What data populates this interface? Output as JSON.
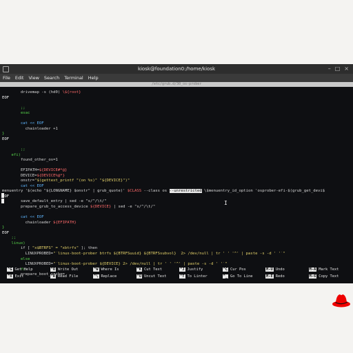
{
  "window": {
    "title": "kiosk@foundation0:/home/kiosk"
  },
  "menu": [
    "File",
    "Edit",
    "View",
    "Search",
    "Terminal",
    "Help"
  ],
  "editor": {
    "header_text": "/etc/grub.d/30_os-prober",
    "lines": [
      [
        {
          "t": "        drivemap -s (hd0) "
        },
        {
          "t": "\\${root}",
          "c": "v"
        }
      ],
      [
        {
          "t": "EOF",
          "c": "w"
        }
      ],
      [
        {
          "t": ""
        }
      ],
      [
        {
          "t": "        ;;",
          "c": "g"
        }
      ],
      [
        {
          "t": "        esac",
          "c": "g"
        }
      ],
      [
        {
          "t": ""
        }
      ],
      [
        {
          "t": "        cat << EOF",
          "c": "k"
        }
      ],
      [
        {
          "t": "          chainloader +1"
        }
      ],
      [
        {
          "t": "}",
          "c": "g"
        }
      ],
      [
        {
          "t": "EOF",
          "c": "w"
        }
      ],
      [
        {
          "t": ""
        }
      ],
      [
        {
          "t": "        ;;",
          "c": "g"
        }
      ],
      [
        {
          "t": "    efi)",
          "c": "g"
        }
      ],
      [
        {
          "t": "        found_other_os=1"
        }
      ],
      [
        {
          "t": ""
        }
      ],
      [
        {
          "t": "        EFIPATH="
        },
        {
          "t": "${DEVICE#*@}",
          "c": "v"
        }
      ],
      [
        {
          "t": "        DEVICE="
        },
        {
          "t": "${DEVICE%@*}",
          "c": "v"
        }
      ],
      [
        {
          "t": "        onstr="
        },
        {
          "t": "\"$(gettext_printf \"(on %s)\" \"${DEVICE}\")\"",
          "c": "s"
        }
      ],
      [
        {
          "t": "        cat << EOF",
          "c": "k"
        }
      ],
      [
        {
          "t": "menuentry '$(echo \"${LONGNAME} $onstr\" | grub_quote)' "
        },
        {
          "t": "$CLASS",
          "c": "v"
        },
        {
          "t": " --class os "
        },
        {
          "t": "--unrestricted",
          "c": "hl"
        },
        {
          "t": " \\$menuentry_id_option 'osprober-efi-$(grub_get_devi$"
        }
      ],
      [
        {
          "t": "EOF",
          "c": "w"
        }
      ],
      [
        {
          "t": "        save_default_entry | sed -e \"s/^/\\t/\""
        }
      ],
      [
        {
          "t": "        prepare_grub_to_access_device "
        },
        {
          "t": "${DEVICE}",
          "c": "v"
        },
        {
          "t": " | sed -e \"s/^/\\t/\""
        }
      ],
      [
        {
          "t": ""
        }
      ],
      [
        {
          "t": "        cat << EOF",
          "c": "k"
        }
      ],
      [
        {
          "t": "          chainloader "
        },
        {
          "t": "${EFIPATH}",
          "c": "v"
        }
      ],
      [
        {
          "t": "}",
          "c": "g"
        }
      ],
      [
        {
          "t": "EOF",
          "c": "w"
        }
      ],
      [
        {
          "t": "    ;;",
          "c": "g"
        }
      ],
      [
        {
          "t": "    linux)",
          "c": "g"
        }
      ],
      [
        {
          "t": "        if [ "
        },
        {
          "t": "\"x$BTRFS\" = \"xbtrfs\"",
          "c": "s"
        },
        {
          "t": " ]; then"
        }
      ],
      [
        {
          "t": "          LINUXPROBED="
        },
        {
          "t": "\"`linux-boot-prober btrfs ${BTRFSuuid} ${BTRFSsubvol}  2> /dev/null | tr ' ' '^' | paste -s -d ' '`\"",
          "c": "s"
        }
      ],
      [
        {
          "t": "        else",
          "c": "g"
        }
      ],
      [
        {
          "t": "          LINUXPROBED="
        },
        {
          "t": "\"`linux-boot-prober ${DEVICE} 2> /dev/null | tr ' ' '^' | paste -s -d ' '`\"",
          "c": "s"
        }
      ],
      [
        {
          "t": "        fi",
          "c": "g"
        }
      ],
      [
        {
          "t": "        prepare_boot_cache="
        }
      ]
    ]
  },
  "shortcuts": [
    {
      "key": "^G",
      "label": "Get Help"
    },
    {
      "key": "^O",
      "label": "Write Out"
    },
    {
      "key": "^W",
      "label": "Where Is"
    },
    {
      "key": "^K",
      "label": "Cut Text"
    },
    {
      "key": "^J",
      "label": "Justify"
    },
    {
      "key": "^C",
      "label": "Cur Pos"
    },
    {
      "key": "M-U",
      "label": "Undo"
    },
    {
      "key": "M-A",
      "label": "Mark Text"
    },
    {
      "key": "^X",
      "label": "Exit"
    },
    {
      "key": "^R",
      "label": "Read File"
    },
    {
      "key": "^\\",
      "label": "Replace"
    },
    {
      "key": "^U",
      "label": "Uncut Text"
    },
    {
      "key": "^T",
      "label": "To Linter"
    },
    {
      "key": "^_",
      "label": "Go To Line"
    },
    {
      "key": "M-E",
      "label": "Redo"
    },
    {
      "key": "M-6",
      "label": "Copy Text"
    }
  ],
  "colors": {
    "keyword": "#5fb6ff",
    "string": "#e7d46b",
    "variable": "#ff6a6a",
    "control": "#58d84b",
    "brand_red": "#ee0000"
  },
  "icons": {
    "logo": "red-hat-logo-icon",
    "mouse": "text-cursor-icon"
  }
}
